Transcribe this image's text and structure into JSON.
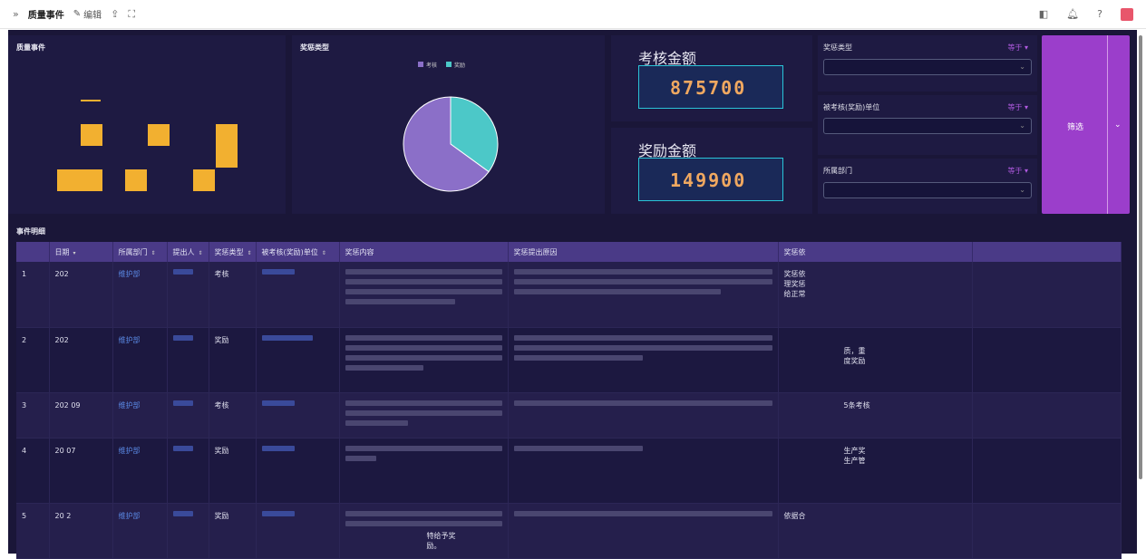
{
  "topbar": {
    "expand_icon": "double-chevron-right-icon",
    "title": "质量事件",
    "edit_label": "编辑",
    "share_icon": "share-icon",
    "fullscreen_icon": "fullscreen-icon"
  },
  "panels": {
    "bar_title": "质量事件",
    "pie_title": "奖惩类型",
    "pie_legend": [
      "考核",
      "奖励"
    ],
    "pie_colors": [
      "#8b6fc8",
      "#4cc8c8"
    ],
    "pie_share": [
      0.65,
      0.35
    ],
    "assess_title": "考核金额",
    "assess_value": "875700",
    "reward_title": "奖励金额",
    "reward_value": "149900"
  },
  "filters": [
    {
      "title": "奖惩类型",
      "op": "等于"
    },
    {
      "title": "被考核(奖励)单位",
      "op": "等于"
    },
    {
      "title": "所属部门",
      "op": "等于"
    }
  ],
  "filter_button": "筛选",
  "section_title": "事件明细",
  "table": {
    "headers": [
      "",
      "日期",
      "所属部门",
      "提出人",
      "奖惩类型",
      "被考核(奖励)单位",
      "奖惩内容",
      "奖惩提出原因",
      "奖惩依",
      ""
    ],
    "rows": [
      {
        "no": "1",
        "date": "202",
        "dept": "维护部",
        "type": "考核",
        "basis": "奖惩依\n理奖惩\n给正常"
      },
      {
        "no": "2",
        "date": "202",
        "dept": "维护部",
        "type": "奖励",
        "basis": "质，重\n度奖励"
      },
      {
        "no": "3",
        "date": "202  09",
        "dept": "维护部",
        "type": "考核",
        "basis": "5条考核"
      },
      {
        "no": "4",
        "date": "20  07",
        "dept": "维护部",
        "type": "奖励",
        "basis": "生产奖\n生产管"
      },
      {
        "no": "5",
        "date": "20  2",
        "dept": "维护部",
        "type": "奖励",
        "content_tail": "特给予奖\n励。",
        "basis": "依据合"
      }
    ]
  }
}
